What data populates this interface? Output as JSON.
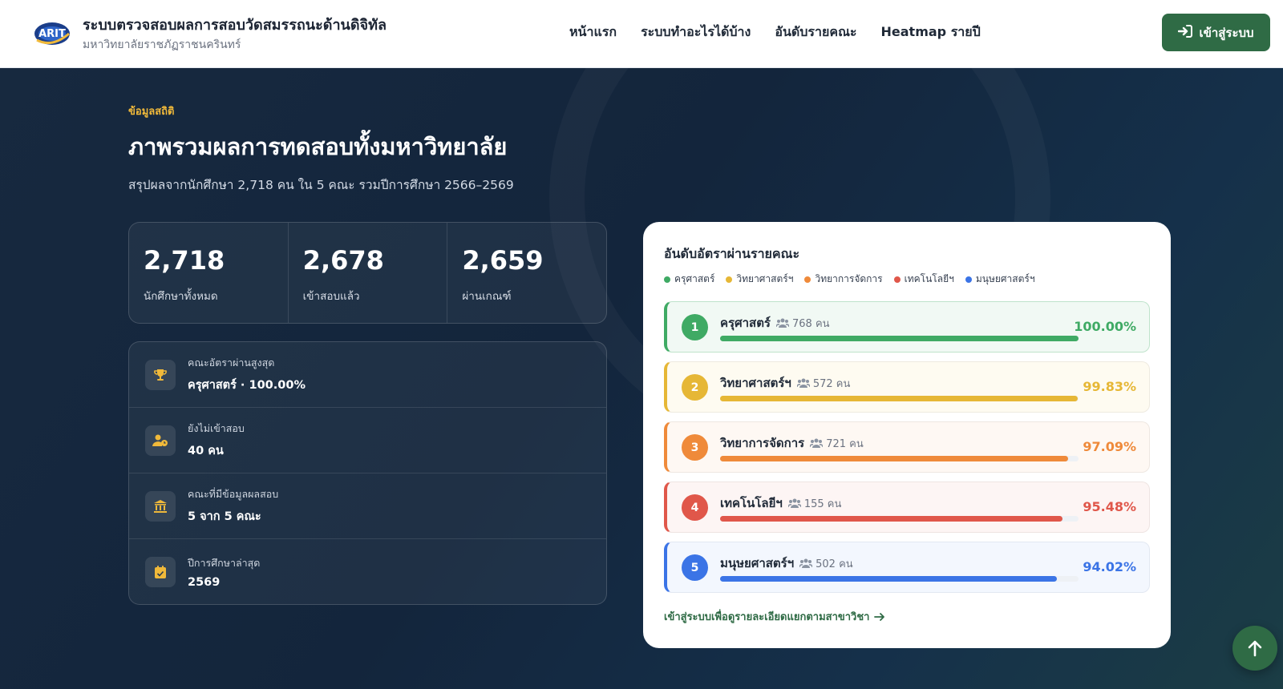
{
  "header": {
    "logo_icon": "university-logo",
    "title": "ระบบตรวจสอบผลการสอบวัดสมรรถนะด้านดิจิทัล",
    "subtitle": "มหาวิทยาลัยราชภัฏราชนครินทร์",
    "nav": [
      {
        "label": "หน้าแรก"
      },
      {
        "label": "ระบบทำอะไรได้บ้าง"
      },
      {
        "label": "อันดับรายคณะ"
      },
      {
        "label": "Heatmap รายปี"
      }
    ],
    "login_label": "เข้าสู่ระบบ",
    "login_icon": "sign-in-icon"
  },
  "hero": {
    "eyebrow": "ข้อมูลสถิติ",
    "title": "ภาพรวมผลการทดสอบทั้งมหาวิทยาลัย",
    "description": "สรุปผลจากนักศึกษา 2,718 คน ใน 5 คณะ รวมปีการศึกษา 2566–2569"
  },
  "stats": [
    {
      "value": "2,718",
      "label": "นักศึกษาทั้งหมด"
    },
    {
      "value": "2,678",
      "label": "เข้าสอบแล้ว"
    },
    {
      "value": "2,659",
      "label": "ผ่านเกณฑ์"
    }
  ],
  "info": [
    {
      "icon": "trophy-icon",
      "label": "คณะอัตราผ่านสูงสุด",
      "value": "ครุศาสตร์ · 100.00%"
    },
    {
      "icon": "user-clock-icon",
      "label": "ยังไม่เข้าสอบ",
      "value": "40 คน"
    },
    {
      "icon": "university-icon",
      "label": "คณะที่มีข้อมูลผลสอบ",
      "value": "5 จาก 5 คณะ"
    },
    {
      "icon": "calendar-check-icon",
      "label": "ปีการศึกษาล่าสุด",
      "value": "2569"
    }
  ],
  "ranking": {
    "title": "อันดับอัตราผ่านรายคณะ",
    "legend": [
      {
        "label": "ครุศาสตร์",
        "color": "#3faa64"
      },
      {
        "label": "วิทยาศาสตร์ฯ",
        "color": "#e6b736"
      },
      {
        "label": "วิทยาการจัดการ",
        "color": "#ef8a3a"
      },
      {
        "label": "เทคโนโลยีฯ",
        "color": "#e0574a"
      },
      {
        "label": "มนุษยศาสตร์ฯ",
        "color": "#3b74e6"
      }
    ],
    "rows": [
      {
        "rank": "1",
        "name": "ครุศาสตร์",
        "count": "768 คน",
        "pct_label": "100.00%",
        "pct": 100.0,
        "color": "#3faa64",
        "bg": "#f1f9f4",
        "border": "#bfe3cb"
      },
      {
        "rank": "2",
        "name": "วิทยาศาสตร์ฯ",
        "count": "572 คน",
        "pct_label": "99.83%",
        "pct": 99.83,
        "color": "#e6b736",
        "bg": "#fefbf1",
        "border": "#eeeae0"
      },
      {
        "rank": "3",
        "name": "วิทยาการจัดการ",
        "count": "721 คน",
        "pct_label": "97.09%",
        "pct": 97.09,
        "color": "#ef8a3a",
        "bg": "#fef8f3",
        "border": "#eee7e1"
      },
      {
        "rank": "4",
        "name": "เทคโนโลยีฯ",
        "count": "155 คน",
        "pct_label": "95.48%",
        "pct": 95.48,
        "color": "#e0574a",
        "bg": "#fdf5f4",
        "border": "#eee4e2"
      },
      {
        "rank": "5",
        "name": "มนุษยศาสตร์ฯ",
        "count": "502 คน",
        "pct_label": "94.02%",
        "pct": 94.02,
        "color": "#3b74e6",
        "bg": "#f3f7fe",
        "border": "#e2e8f2"
      }
    ],
    "link_label": "เข้าสู่ระบบเพื่อดูรายละเอียดแยกตามสาขาวิชา",
    "link_icon": "arrow-right-icon"
  },
  "scroll_top_icon": "arrow-up-icon"
}
